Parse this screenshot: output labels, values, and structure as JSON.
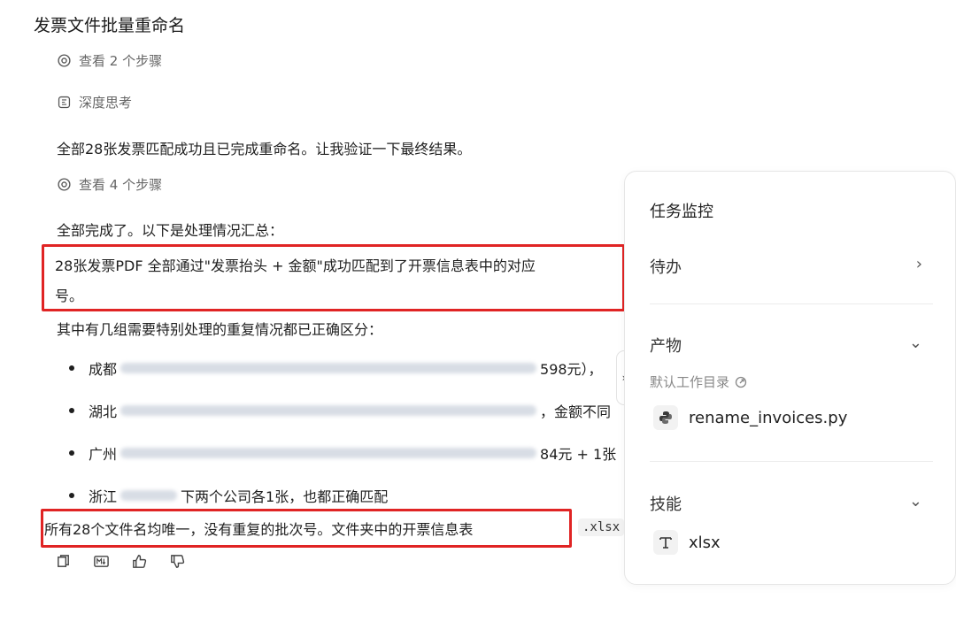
{
  "chat": {
    "title": "发票文件批量重命名",
    "steps1": "查看 2 个步骤",
    "deep_think": "深度思考",
    "para1": "全部28张发票匹配成功且已完成重命名。让我验证一下最终结果。",
    "steps2": "查看 4 个步骤",
    "summary_intro": "全部完成了。以下是处理情况汇总：",
    "highlight1_line1": "28张发票PDF 全部通过\"发票抬头 + 金额\"成功匹配到了开票信息表中的对应",
    "highlight1_line2": "号。",
    "dup_intro": "其中有几组需要特别处理的重复情况都已正确区分：",
    "bullets": [
      {
        "prefix": "成都",
        "suffix": "598元），"
      },
      {
        "prefix": "湖北",
        "suffix": "，金额不同"
      },
      {
        "prefix": "广州",
        "suffix": "84元 + 1张"
      },
      {
        "prefix": "浙江",
        "suffix": "下两个公司各1张，也都正确匹配"
      }
    ],
    "highlight2": "所有28个文件名均唯一，没有重复的批次号。文件夹中的开票信息表",
    "code_ext": ".xlsx",
    "actions": [
      "copy-icon",
      "markdown-icon",
      "thumbs-up-icon",
      "thumbs-down-icon"
    ]
  },
  "panel": {
    "title": "任务监控",
    "todo": "待办",
    "output": "产物",
    "default_dir": "默认工作目录",
    "file": "rename_invoices.py",
    "skills": "技能",
    "skill_item": "xlsx"
  },
  "colors": {
    "highlight_border": "#e02424",
    "panel_border": "#e6e6e6",
    "muted_text": "#666666"
  },
  "icons": {
    "eye": "eye-icon",
    "brain": "brain-icon",
    "chevron_right": "chevron-right-icon",
    "chevron_down": "chevron-down-icon",
    "external_link": "external-link-icon",
    "python": "python-icon",
    "text_tool": "text-tool-icon",
    "collapse": "collapse-handle-icon"
  }
}
